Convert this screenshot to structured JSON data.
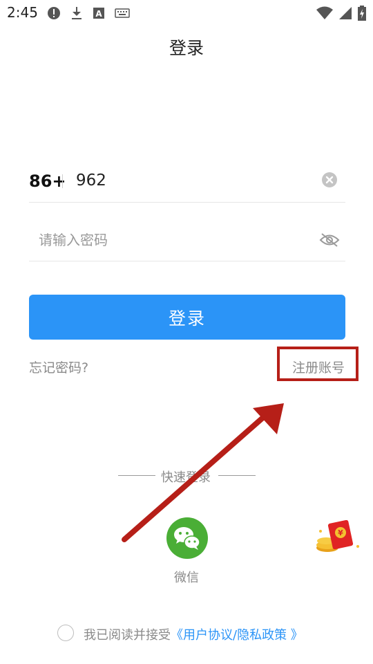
{
  "status_bar": {
    "time": "2:45",
    "left_icons": [
      "alert-icon",
      "download-icon",
      "a-box-icon",
      "keyboard-icon"
    ],
    "right_icons": [
      "wifi-icon",
      "signal-icon",
      "battery-charging-icon"
    ]
  },
  "header": {
    "title": "登录"
  },
  "form": {
    "country_code": "86+",
    "phone_value": "962",
    "password_placeholder": "请输入密码",
    "login_label": "登录",
    "forgot_label": "忘记密码?",
    "register_label": "注册账号"
  },
  "quick_login": {
    "label": "快速登录",
    "wechat_label": "微信"
  },
  "agreement": {
    "prefix": "我已阅读并接受",
    "link": "《用户协议/隐私政策 》"
  },
  "colors": {
    "primary": "#2b94f7",
    "wechat": "#4aae36",
    "annotation": "#b61f18"
  }
}
